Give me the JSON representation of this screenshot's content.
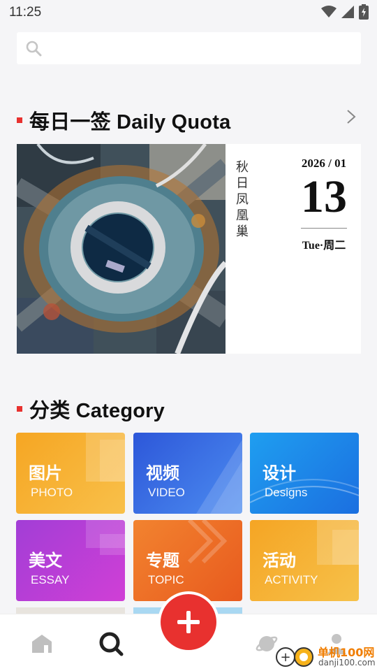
{
  "status_bar": {
    "time": "11:25",
    "icons": [
      "wifi-icon",
      "signal-icon",
      "battery-icon"
    ]
  },
  "search": {
    "placeholder": "",
    "icon": "search-icon"
  },
  "daily": {
    "title": "每日一签 Daily Quota",
    "poem_chars": [
      "秋",
      "日",
      "凤",
      "凰",
      "巢"
    ],
    "year_month": "2026 / 01",
    "day": "13",
    "weekday": "Tue·周二",
    "more_icon": "chevron-right-icon"
  },
  "category": {
    "title": "分类 Category",
    "tiles": [
      {
        "zh": "图片",
        "en": "PHOTO"
      },
      {
        "zh": "视频",
        "en": "VIDEO"
      },
      {
        "zh": "设计",
        "en": "Designs"
      },
      {
        "zh": "美文",
        "en": "ESSAY"
      },
      {
        "zh": "专题",
        "en": "TOPIC"
      },
      {
        "zh": "活动",
        "en": "ACTIVITY"
      }
    ]
  },
  "bottom_nav": {
    "items": [
      "home-icon",
      "discover-icon",
      "add-icon",
      "planet-icon",
      "profile-icon"
    ]
  },
  "watermark": {
    "text_zh": "单机100网",
    "text_en": "danji100.com"
  },
  "colors": {
    "accent": "#e8312f",
    "background": "#f5f5f7"
  }
}
